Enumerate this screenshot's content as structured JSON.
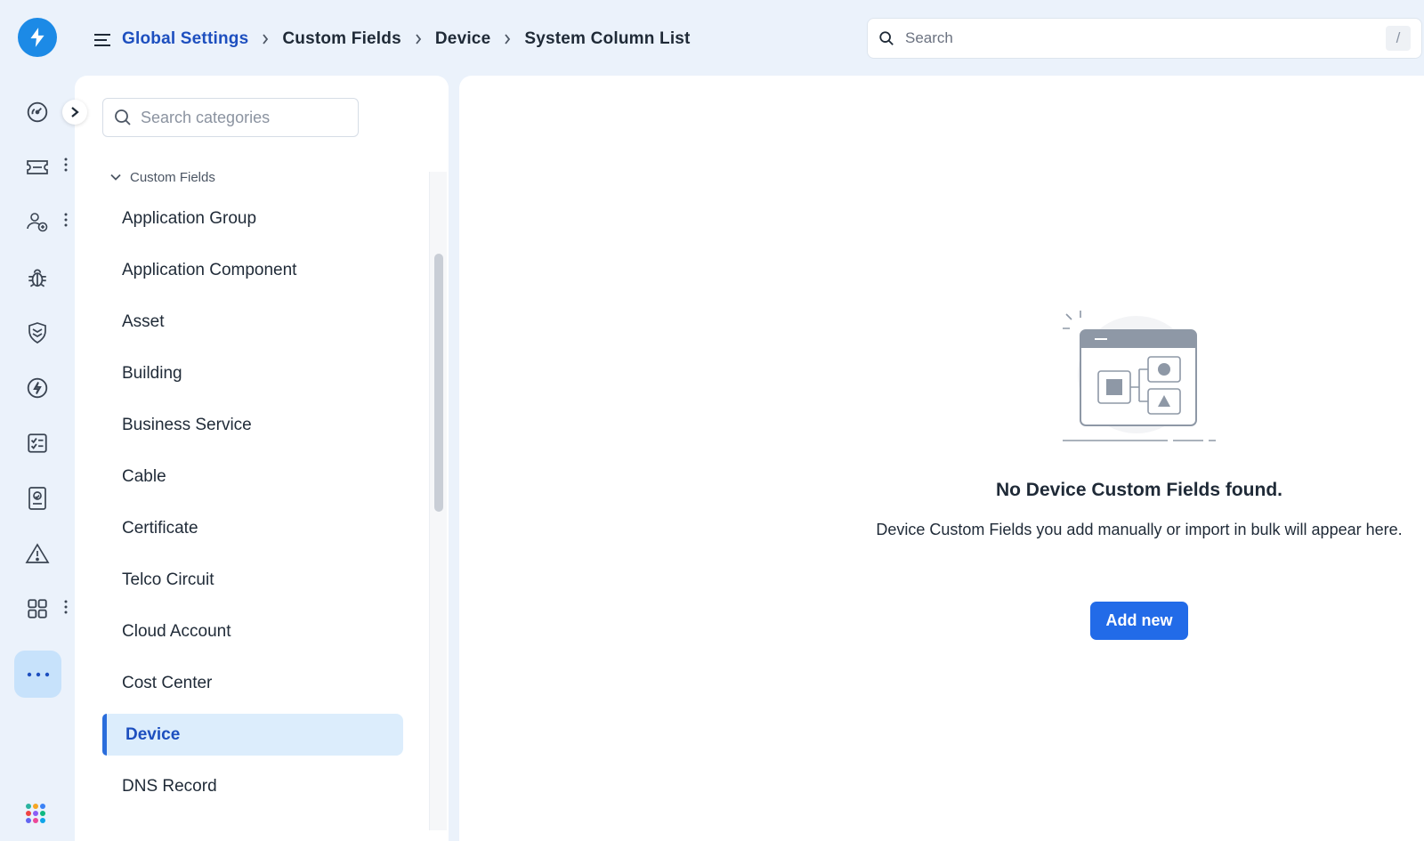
{
  "brand": {
    "logo_icon": "lightning-bolt-icon",
    "accent": "#1c8ae6"
  },
  "rail": {
    "items": [
      {
        "icon": "dashboard-gauge-icon",
        "has_menu": false
      },
      {
        "icon": "ticket-icon",
        "has_menu": true
      },
      {
        "icon": "users-settings-icon",
        "has_menu": true
      },
      {
        "icon": "bug-icon",
        "has_menu": false
      },
      {
        "icon": "shield-icon",
        "has_menu": false
      },
      {
        "icon": "change-bolt-icon",
        "has_menu": false
      },
      {
        "icon": "checklist-icon",
        "has_menu": false
      },
      {
        "icon": "badge-contact-icon",
        "has_menu": false
      },
      {
        "icon": "warning-icon",
        "has_menu": false
      },
      {
        "icon": "grid-apps-icon",
        "has_menu": true
      }
    ],
    "more_icon": "ellipsis-icon",
    "apps_icon": "colored-dots-apps-icon"
  },
  "header": {
    "breadcrumb": [
      {
        "label": "Global Settings",
        "link": true
      },
      {
        "label": "Custom Fields",
        "link": false
      },
      {
        "label": "Device",
        "link": false
      },
      {
        "label": "System Column List",
        "link": false
      }
    ],
    "search": {
      "placeholder": "Search",
      "shortcut": "/"
    }
  },
  "categories": {
    "search_placeholder": "Search categories",
    "group_label": "Custom Fields",
    "items": [
      "Application Group",
      "Application Component",
      "Asset",
      "Building",
      "Business Service",
      "Cable",
      "Certificate",
      "Telco Circuit",
      "Cloud Account",
      "Cost Center",
      "Device",
      "DNS Record"
    ],
    "active": "Device"
  },
  "empty_state": {
    "title": "No Device Custom Fields found.",
    "description": "Device Custom Fields you add manually or import in bulk will appear here.",
    "button_label": "Add new",
    "button_color": "#226be8"
  }
}
